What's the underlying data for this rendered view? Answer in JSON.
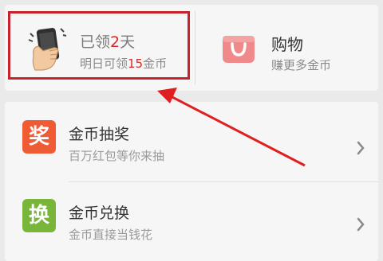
{
  "checkin": {
    "title_prefix": "已领",
    "title_days": "2",
    "title_suffix": "天",
    "sub_prefix": "明日可领",
    "sub_coins": "15",
    "sub_suffix": "金币"
  },
  "shopping": {
    "title": "购物",
    "subtitle": "赚更多金币"
  },
  "list": {
    "items": [
      {
        "badge": "奖",
        "title": "金币抽奖",
        "subtitle": "百万红包等你来抽",
        "color": "#ef5b34"
      },
      {
        "badge": "换",
        "title": "金币兑换",
        "subtitle": "金币直接当钱花",
        "color": "#79b53b"
      }
    ]
  },
  "colors": {
    "highlight": "#c8232c",
    "accent_red": "#d42a2a",
    "bag": "#f08a8a"
  },
  "icons": {
    "checkin": "hand-holding-phone-icon",
    "shopping": "shopping-bag-icon",
    "chevron": "chevron-right-icon"
  }
}
